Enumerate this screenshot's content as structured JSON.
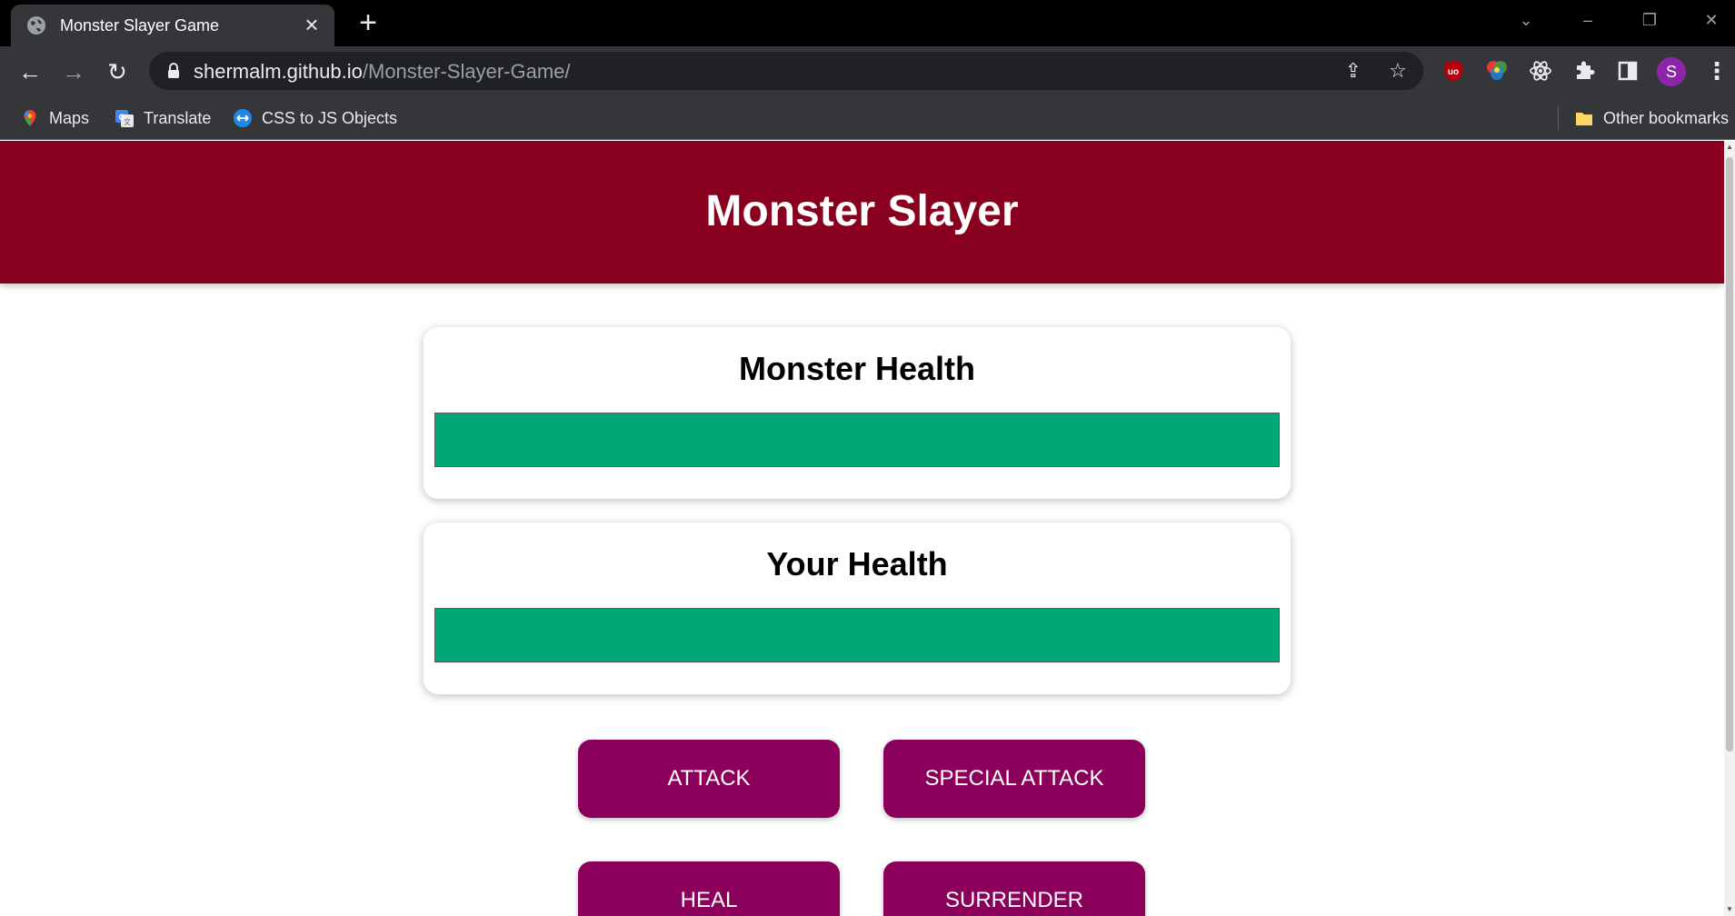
{
  "browser": {
    "tab_title": "Monster Slayer Game",
    "url_host": "shermalm.github.io",
    "url_path": "/Monster-Slayer-Game/",
    "bookmarks": [
      {
        "label": "Maps",
        "icon": "maps-icon"
      },
      {
        "label": "Translate",
        "icon": "translate-icon"
      },
      {
        "label": "CSS to JS Objects",
        "icon": "css-to-js-icon"
      }
    ],
    "other_bookmarks_label": "Other bookmarks",
    "profile_initial": "S"
  },
  "page": {
    "title": "Monster Slayer",
    "monster_health": {
      "label": "Monster Health",
      "percent": 100
    },
    "player_health": {
      "label": "Your Health",
      "percent": 100
    },
    "actions": {
      "attack": "ATTACK",
      "special_attack": "SPECIAL ATTACK",
      "heal": "HEAL",
      "surrender": "SURRENDER"
    }
  },
  "colors": {
    "header_bg": "#88001e",
    "health_fill": "#00a876",
    "button_bg": "#8a005b"
  }
}
